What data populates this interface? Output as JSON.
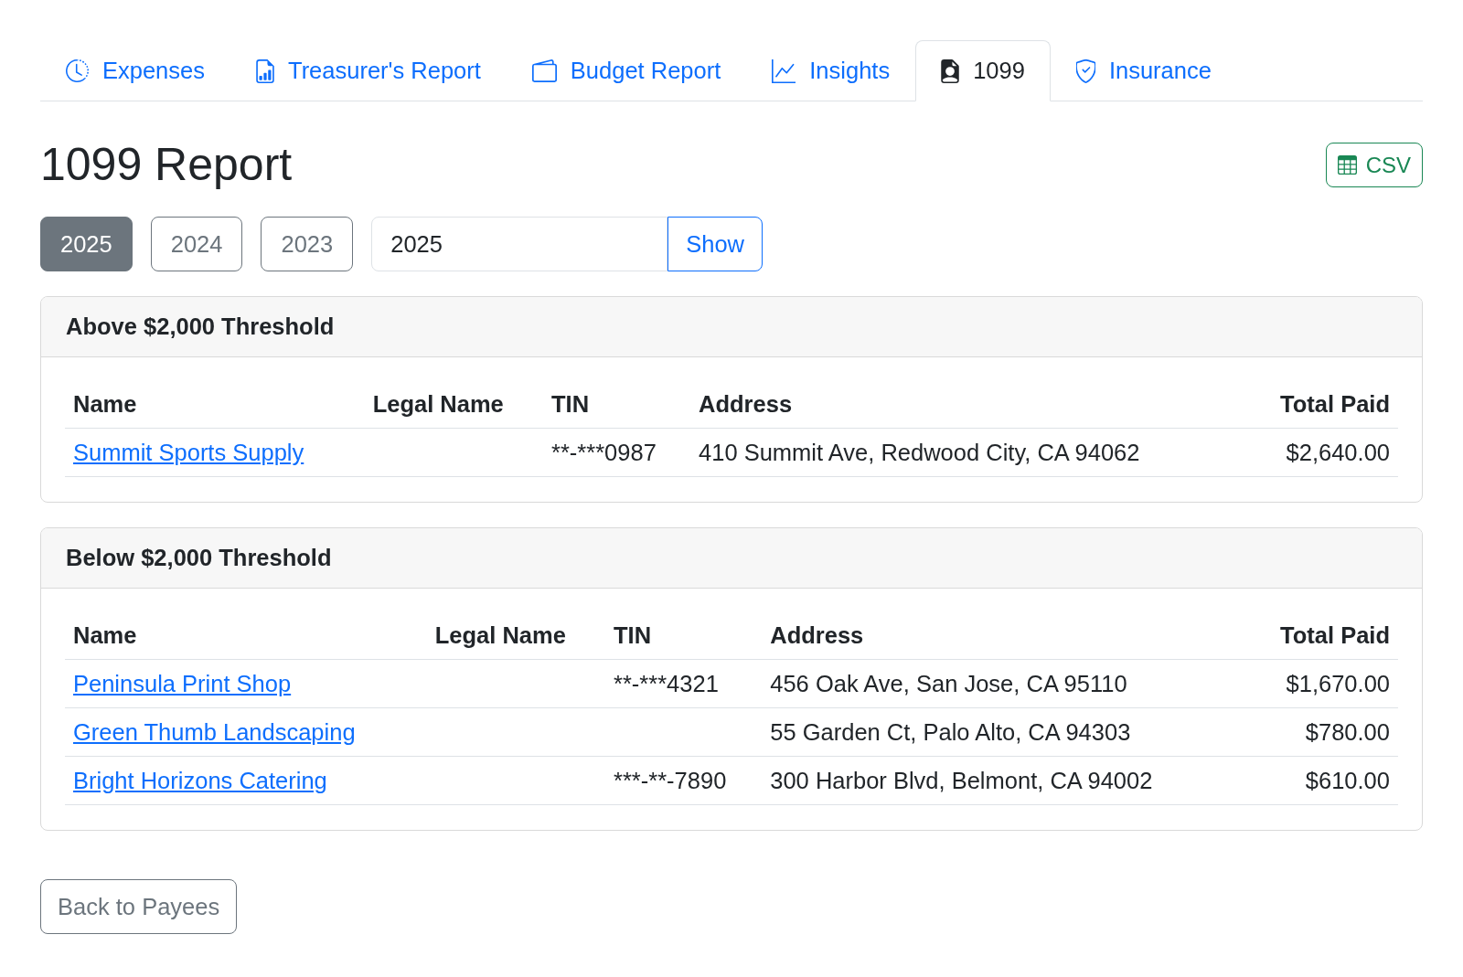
{
  "tabs": [
    {
      "label": "Expenses",
      "selected": false
    },
    {
      "label": "Treasurer's Report",
      "selected": false
    },
    {
      "label": "Budget Report",
      "selected": false
    },
    {
      "label": "Insights",
      "selected": false
    },
    {
      "label": "1099",
      "selected": true
    },
    {
      "label": "Insurance",
      "selected": false
    }
  ],
  "header": {
    "title": "1099 Report",
    "export_button": "CSV"
  },
  "year_filter": {
    "years": [
      {
        "label": "2025",
        "selected": true
      },
      {
        "label": "2024",
        "selected": false
      },
      {
        "label": "2023",
        "selected": false
      }
    ],
    "year_field": {
      "value": "2025"
    },
    "show_button": "Show"
  },
  "sections": [
    {
      "title": "Above $2,000 Threshold",
      "columns": [
        "Name",
        "Legal Name",
        "TIN",
        "Address",
        "Total Paid"
      ],
      "rows": [
        {
          "name": "Summit Sports Supply",
          "tin": "**-***0987",
          "address": "410 Summit Ave, Redwood City, CA 94062",
          "total_paid": "$2,640.00"
        }
      ]
    },
    {
      "title": "Below $2,000 Threshold",
      "columns": [
        "Name",
        "Legal Name",
        "TIN",
        "Address",
        "Total Paid"
      ],
      "rows": [
        {
          "name": "Peninsula Print Shop",
          "tin": "**-***4321",
          "address": "456 Oak Ave, San Jose, CA 95110",
          "total_paid": "$1,670.00"
        },
        {
          "name": "Green Thumb Landscaping",
          "address": "55 Garden Ct, Palo Alto, CA 94303",
          "total_paid": "$780.00"
        },
        {
          "name": "Bright Horizons Catering",
          "tin": "***-**-7890",
          "address": "300 Harbor Blvd, Belmont, CA 94002",
          "total_paid": "$610.00"
        }
      ]
    }
  ],
  "back_button": "Back to Payees"
}
